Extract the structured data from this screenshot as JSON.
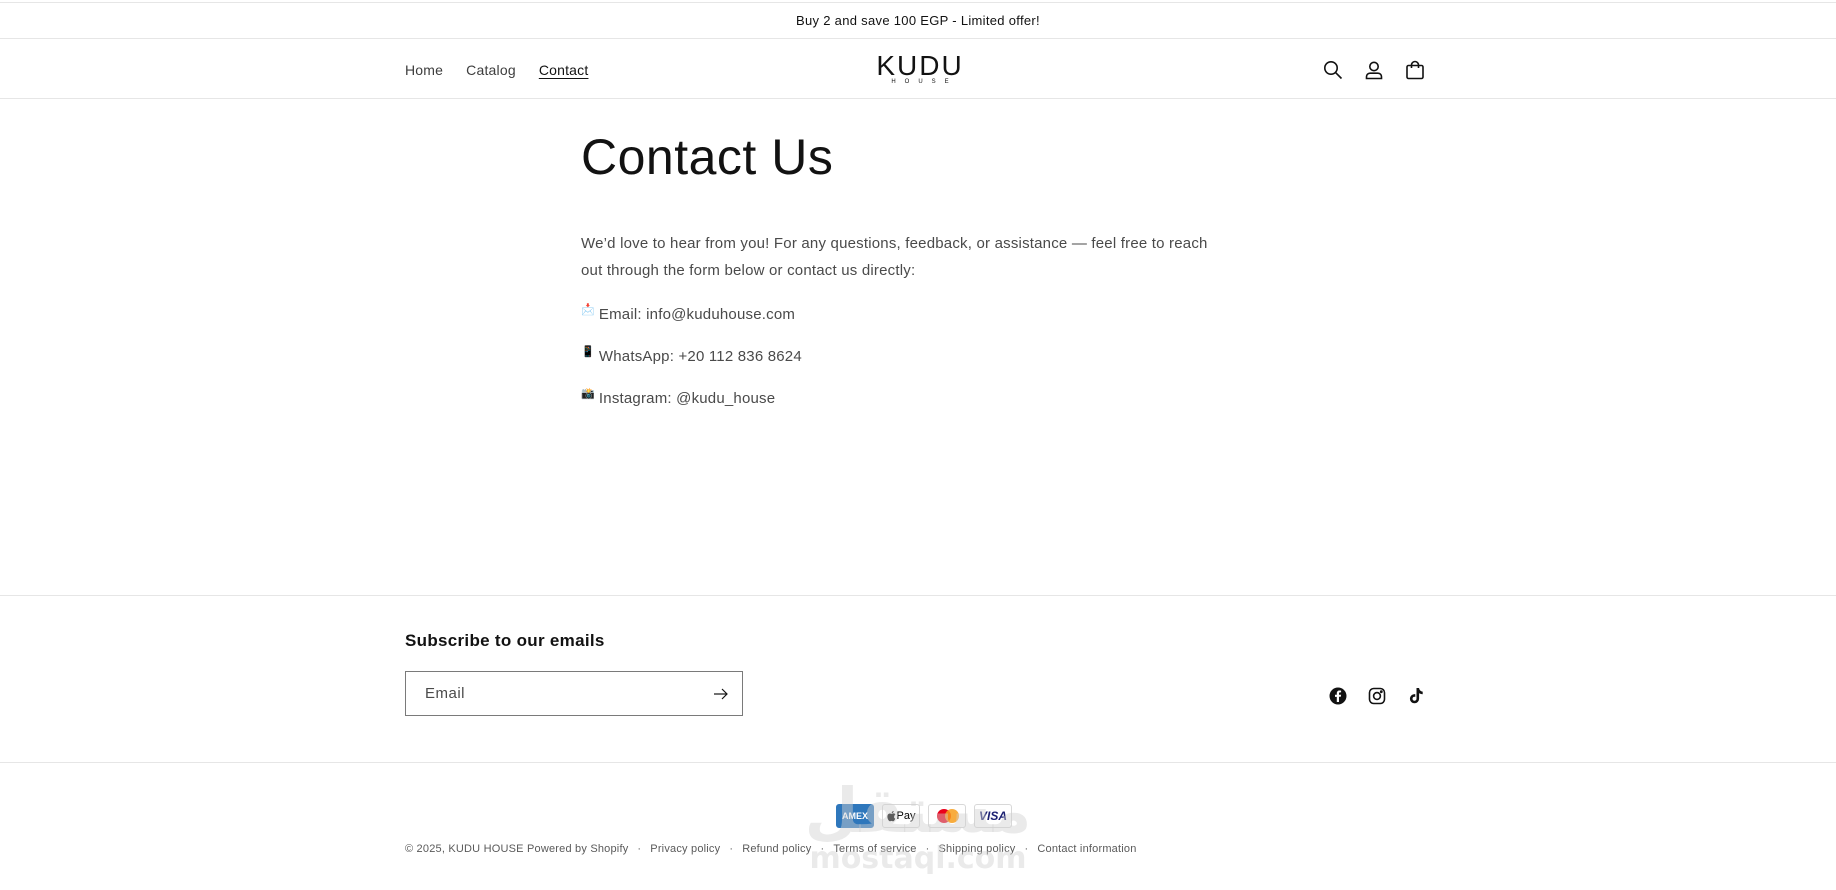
{
  "announcement": {
    "text": "Buy 2 and save 100 EGP - Limited offer!"
  },
  "header": {
    "nav": [
      {
        "label": "Home"
      },
      {
        "label": "Catalog"
      },
      {
        "label": "Contact"
      }
    ],
    "logo": {
      "main": "KUDU",
      "sub": "HOUSE"
    },
    "icons": [
      "search-icon",
      "account-icon",
      "cart-icon"
    ]
  },
  "main": {
    "title": "Contact Us",
    "intro": "We’d love to hear from you! For any questions, feedback, or assistance — feel free to reach out through the form below or contact us directly:",
    "contacts": [
      {
        "emoji": "📩",
        "text": "Email: info@kuduhouse.com"
      },
      {
        "emoji": "📱",
        "text": "WhatsApp: +20 112 836 8624"
      },
      {
        "emoji": "📸",
        "text": "Instagram: @kudu_house"
      }
    ]
  },
  "footer": {
    "subscribe_title": "Subscribe to our emails",
    "email_placeholder": "Email",
    "social": [
      "facebook-icon",
      "instagram-icon",
      "tiktok-icon"
    ],
    "payments": {
      "amex": "AMEX",
      "apple": "Pay",
      "visa": "VISA"
    },
    "copyright": "© 2025,",
    "store_name": "KUDU HOUSE",
    "powered": "Powered by Shopify",
    "links": [
      "Privacy policy",
      "Refund policy",
      "Terms of service",
      "Shipping policy",
      "Contact information"
    ]
  },
  "watermark": {
    "arabic": "مستقل",
    "latin": "mostaql.com"
  }
}
